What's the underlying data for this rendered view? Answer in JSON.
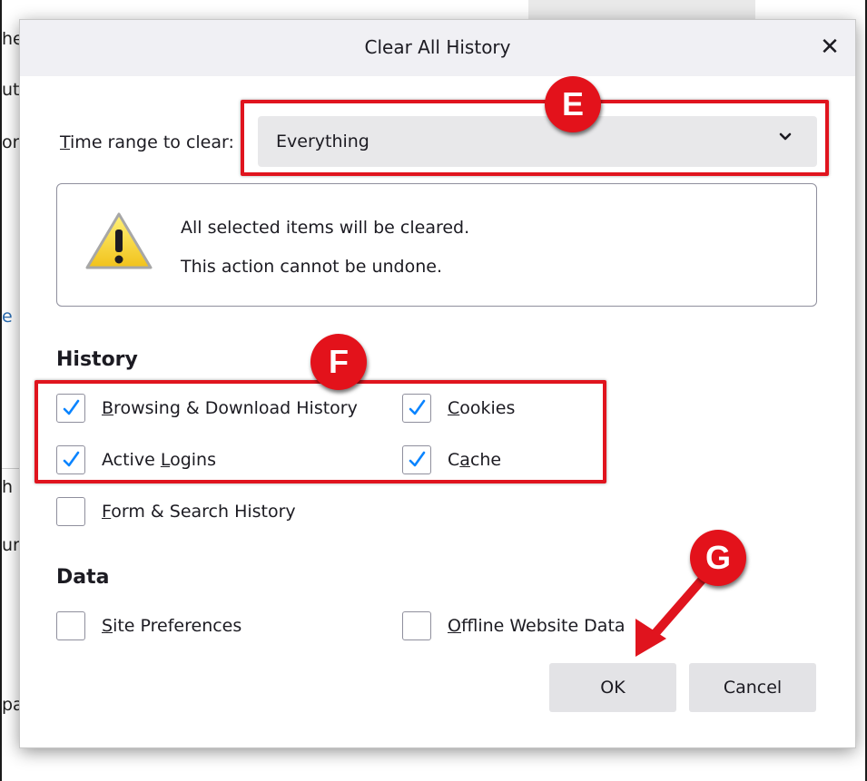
{
  "background": {
    "fragments": [
      "he",
      "ut",
      "ore",
      "e",
      "h",
      "ur",
      "pa"
    ]
  },
  "dialog": {
    "title": "Clear All History",
    "close_glyph": "✕",
    "time_range": {
      "label_accel": "T",
      "label_rest": "ime range to clear:",
      "value": "Everything"
    },
    "warning": {
      "line1": "All selected items will be cleared.",
      "line2": "This action cannot be undone."
    },
    "history": {
      "heading": "History",
      "items": [
        {
          "accel": "B",
          "rest": "rowsing & Download History",
          "checked": true
        },
        {
          "accel": "C",
          "rest": "ookies",
          "checked": true
        },
        {
          "pre": "Active ",
          "accel": "L",
          "rest": "ogins",
          "checked": true
        },
        {
          "pre": "C",
          "accel": "a",
          "rest": "che",
          "checked": true
        },
        {
          "accel": "F",
          "rest": "orm & Search History",
          "checked": false
        }
      ]
    },
    "data": {
      "heading": "Data",
      "items": [
        {
          "accel": "S",
          "rest": "ite Preferences",
          "checked": false
        },
        {
          "accel": "O",
          "rest": "ffline Website Data",
          "checked": false
        }
      ]
    },
    "buttons": {
      "ok": "OK",
      "cancel": "Cancel"
    }
  },
  "annotations": {
    "E": "E",
    "F": "F",
    "G": "G",
    "color": "#e0141e"
  },
  "colors": {
    "checkmark": "#0a84ff",
    "dialog_bg": "#ffffff",
    "titlebar_bg": "#f0f0f4"
  }
}
